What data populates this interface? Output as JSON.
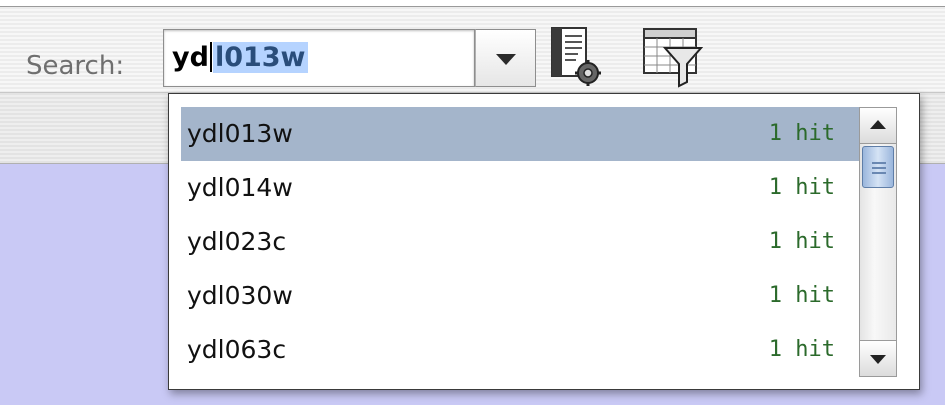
{
  "toolbar": {
    "search_label": "Search:",
    "search_value_typed": "yd",
    "search_value_autocomplete": "l013w",
    "dropdown_icon": "chevron-down-icon",
    "tool_icons": [
      "document-settings-icon",
      "table-filter-icon"
    ]
  },
  "popup": {
    "items": [
      {
        "label": "ydl013w",
        "hits": "1 hit",
        "selected": true
      },
      {
        "label": "ydl014w",
        "hits": "1 hit",
        "selected": false
      },
      {
        "label": "ydl023c",
        "hits": "1 hit",
        "selected": false
      },
      {
        "label": "ydl030w",
        "hits": "1 hit",
        "selected": false
      },
      {
        "label": "ydl063c",
        "hits": "1 hit",
        "selected": false
      }
    ]
  },
  "colors": {
    "selected_row": "#a4b5cb",
    "hits_text": "#2b6a2b",
    "content_background": "#c9c9f5"
  }
}
